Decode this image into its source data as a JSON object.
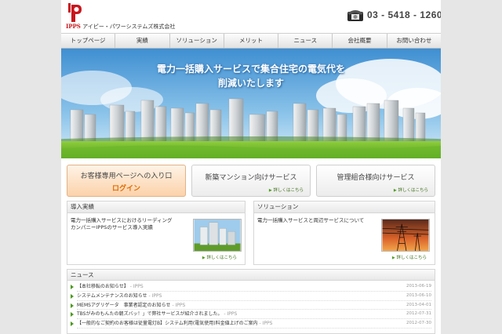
{
  "header": {
    "logo_brand": "IPPS",
    "logo_company": "アイピー・パワーシステムズ株式会社",
    "phone": "03 - 5418 - 1260"
  },
  "nav": [
    {
      "label": "トップページ"
    },
    {
      "label": "実績"
    },
    {
      "label": "ソリューション"
    },
    {
      "label": "メリット"
    },
    {
      "label": "ニュース"
    },
    {
      "label": "会社概要"
    },
    {
      "label": "お問い合わせ"
    }
  ],
  "hero": {
    "line1": "電力一括購入サービスで集合住宅の電気代を",
    "line2": "削減いたします"
  },
  "boxes": {
    "login_title": "お客様専用ページへの入り口",
    "login_label": "ログイン",
    "new_mansion_title": "新築マンション向けサービス",
    "association_title": "管理組合様向けサービス",
    "details_link": "詳しくはこちら"
  },
  "results": {
    "heading": "導入実績",
    "text_line1": "電力一括購入サービスにおけるリーディング",
    "text_line2": "カンパニーIPPSのサービス導入実績",
    "link": "詳しくはこちら"
  },
  "solution": {
    "heading": "ソリューション",
    "text": "電力一括購入サービスと周辺サービスについて",
    "link": "詳しくはこちら"
  },
  "news": {
    "heading": "ニュース",
    "separator": " - ",
    "items": [
      {
        "title": "【本社移転のお知らせ】",
        "source": "IPPS",
        "date": "2013-06-19"
      },
      {
        "title": "システムメンテナンスのお知らせ",
        "source": "IPPS",
        "date": "2013-06-10"
      },
      {
        "title": "MEMSアグリゲータ　事業者認定のお知らせ",
        "source": "IPPS",
        "date": "2013-04-01"
      },
      {
        "title": "TBSがみのもんたの朝ズバッ！」で弊社サービスが紹介されました。",
        "source": "IPPS",
        "date": "2012-07-31"
      },
      {
        "title": "【一般的なご契約のお客様は従量電灯B】システム利用(電気使用)料金値上げのご案内",
        "source": "IPPS",
        "date": "2012-07-30"
      }
    ]
  },
  "colors": {
    "brand_red": "#c8161d",
    "accent_orange": "#e06a00",
    "link_green": "#3a6d15",
    "sky_blue": "#5fa7dd",
    "grass_green": "#6fb52c"
  }
}
